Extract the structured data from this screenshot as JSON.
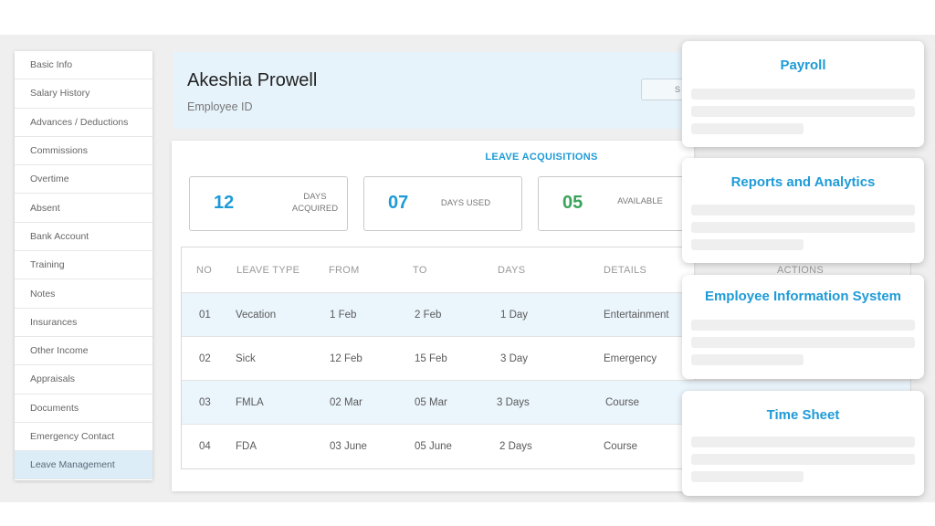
{
  "sidebar": {
    "items": [
      {
        "label": "Basic Info"
      },
      {
        "label": "Salary History"
      },
      {
        "label": "Advances / Deductions"
      },
      {
        "label": "Commissions"
      },
      {
        "label": "Overtime"
      },
      {
        "label": "Absent"
      },
      {
        "label": "Bank Account"
      },
      {
        "label": "Training"
      },
      {
        "label": "Notes"
      },
      {
        "label": "Insurances"
      },
      {
        "label": "Other Income"
      },
      {
        "label": "Appraisals"
      },
      {
        "label": "Documents"
      },
      {
        "label": "Emergency Contact"
      },
      {
        "label": "Leave Management"
      }
    ],
    "active_index": 14
  },
  "header": {
    "employee_name": "Akeshia Prowell",
    "employee_id_label": "Employee ID",
    "button_label": "S"
  },
  "leave": {
    "title": "LEAVE ACQUISITIONS",
    "stats": [
      {
        "value": "12",
        "label": "DAYS ACQUIRED",
        "color": "#1e9bd7"
      },
      {
        "value": "07",
        "label": "DAYS USED",
        "color": "#1e9bd7"
      },
      {
        "value": "05",
        "label": "AVAILABLE",
        "color": "#3aa35a"
      }
    ],
    "columns": [
      "NO",
      "LEAVE TYPE",
      "FROM",
      "TO",
      "DAYS",
      "DETAILS",
      "ACTIONS"
    ],
    "rows": [
      {
        "no": "01",
        "type": "Vecation",
        "from": "1 Feb",
        "to": "2 Feb",
        "days": "1 Day",
        "details": "Entertainment"
      },
      {
        "no": "02",
        "type": "Sick",
        "from": "12 Feb",
        "to": "15 Feb",
        "days": "3 Day",
        "details": "Emergency"
      },
      {
        "no": "03",
        "type": "FMLA",
        "from": "02 Mar",
        "to": "05 Mar",
        "days": "3 Days",
        "details": "Course"
      },
      {
        "no": "04",
        "type": "FDA",
        "from": "03 June",
        "to": "05 June",
        "days": "2 Days",
        "details": "Course"
      }
    ]
  },
  "modules": [
    {
      "title": "Payroll"
    },
    {
      "title": "Reports and Analytics"
    },
    {
      "title": "Employee Information System"
    },
    {
      "title": "Time Sheet"
    }
  ],
  "colors": {
    "accent": "#1e9bd7",
    "available": "#3aa35a",
    "active_row": "#ebf5fc",
    "header_bg": "#e7f3fb"
  }
}
